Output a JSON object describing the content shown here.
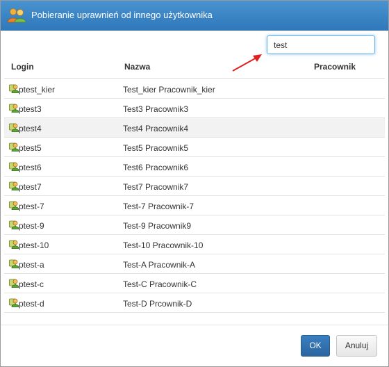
{
  "dialog": {
    "title": "Pobieranie uprawnień od innego użytkownika",
    "icon": "users-icon"
  },
  "search": {
    "value": "test"
  },
  "table": {
    "columns": [
      "Login",
      "Nazwa",
      "Pracownik"
    ],
    "row_icon": "user-icon",
    "rows": [
      {
        "login": "ptest_kier",
        "name": "Test_kier Pracownik_kier"
      },
      {
        "login": "ptest3",
        "name": "Test3 Pracownik3"
      },
      {
        "login": "ptest4",
        "name": "Test4 Pracownik4"
      },
      {
        "login": "ptest5",
        "name": "Test5 Pracownik5"
      },
      {
        "login": "ptest6",
        "name": "Test6 Pracownik6"
      },
      {
        "login": "ptest7",
        "name": "Test7 Pracownik7"
      },
      {
        "login": "ptest-7",
        "name": "Test-7 Pracownik-7"
      },
      {
        "login": "ptest-9",
        "name": "Test-9 Pracownik9"
      },
      {
        "login": "ptest-10",
        "name": "Test-10 Pracownik-10"
      },
      {
        "login": "ptest-a",
        "name": "Test-A Pracownik-A"
      },
      {
        "login": "ptest-c",
        "name": "Test-C Pracownik-C"
      },
      {
        "login": "ptest-d",
        "name": "Test-D Prcownik-D"
      }
    ],
    "highlighted_row": 2
  },
  "buttons": {
    "ok": "OK",
    "cancel": "Anuluj"
  },
  "colors": {
    "titlebar": "#3b84c4",
    "primary": "#2e6da4",
    "arrow": "#e02020"
  }
}
